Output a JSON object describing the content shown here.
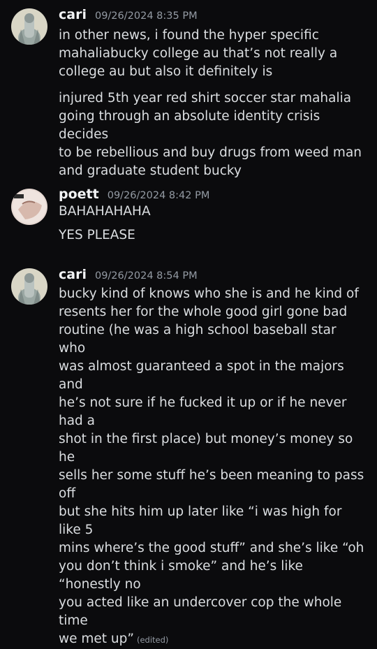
{
  "colors": {
    "background": "#0b0b0d",
    "author": "#f2f3f5",
    "text": "#dbdee1",
    "timestamp": "#949ba4"
  },
  "messages": [
    {
      "author": "cari",
      "timestamp": "09/26/2024 8:35 PM",
      "avatar_icon": "avatar-cari",
      "paragraphs": [
        "in other news, i found the hyper specific\nmahaliabucky college au that’s not really a\ncollege au but also it definitely is",
        "injured 5th year red shirt soccer star mahalia\ngoing through an absolute identity crisis decides\nto be rebellious and buy drugs from weed man\nand graduate student bucky"
      ]
    },
    {
      "author": "poett",
      "timestamp": "09/26/2024 8:42 PM",
      "avatar_icon": "avatar-poett",
      "paragraphs": [
        "BAHAHAHAHA",
        "YES PLEASE"
      ]
    },
    {
      "author": "cari",
      "timestamp": "09/26/2024 8:54 PM",
      "avatar_icon": "avatar-cari",
      "paragraphs": [
        "bucky kind of knows who she is and he kind of\nresents her for the whole good girl gone bad\nroutine (he was a high school baseball star who\nwas almost guaranteed a spot in the majors and\nhe’s not sure if he fucked it up or if he never had a\nshot in the first place) but money’s money so he\nsells her some stuff he’s been meaning to pass off\nbut she hits him up later like “i was high for like 5\nmins where’s the good stuff” and she’s like “oh\nyou don’t think i smoke” and he’s like “honestly no\nyou acted like an undercover cop the whole time\nwe met up”"
      ],
      "edited_label": "(edited)"
    }
  ]
}
